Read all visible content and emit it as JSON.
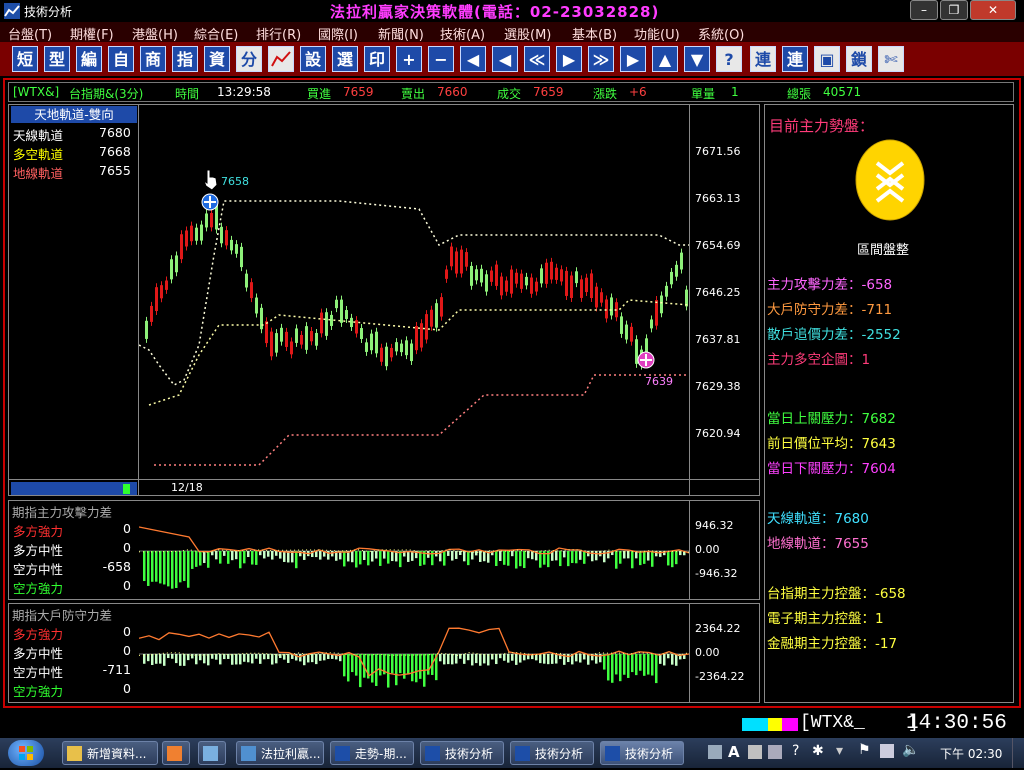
{
  "window": {
    "app_name": "技術分析",
    "heading": "法拉利贏家決策軟體(電話：02-23032828)"
  },
  "menu": [
    "台盤(T)",
    "期權(F)",
    "港盤(H)",
    "綜合(E)",
    "排行(R)",
    "國際(I)",
    "新聞(N)",
    "技術(A)",
    "選股(M)",
    "基本(B)",
    "功能(U)",
    "系統(O)"
  ],
  "toolbar": {
    "buttons": [
      "短",
      "型",
      "編",
      "自",
      "商",
      "指",
      "資",
      "分",
      "▲",
      "設",
      "選",
      "印",
      "+",
      "−",
      "◀",
      "◀",
      "≪",
      "▶",
      "≫",
      "▶",
      "▲",
      "▼",
      "?",
      "連",
      "連",
      "▣",
      "鎖",
      "✄"
    ]
  },
  "info_bar": {
    "symbol": "[WTX&]",
    "name_label": "台指期&(3分)",
    "time_label": "時間",
    "time": "13:29:58",
    "bid_label": "買進",
    "bid": "7659",
    "ask_label": "賣出",
    "ask": "7660",
    "deal_label": "成交",
    "deal": "7659",
    "change_label": "漲跌",
    "change": "+6",
    "vol_label": "單量",
    "vol": "1",
    "total_label": "總張",
    "total": "40571"
  },
  "main_chart": {
    "legend_title": "天地軌道-雙向",
    "legend": [
      {
        "label": "天線軌道",
        "value": "7680",
        "color": "#ffffff"
      },
      {
        "label": "多空軌道",
        "value": "7668",
        "color": "#ffff00"
      },
      {
        "label": "地線軌道",
        "value": "7655",
        "color": "#ff6060"
      }
    ],
    "date_label": "12/18",
    "y_ticks": [
      "7671.56",
      "7663.13",
      "7654.69",
      "7646.25",
      "7637.81",
      "7629.38",
      "7620.94"
    ],
    "high_label": "7658",
    "low_label": "7639"
  },
  "sub1": {
    "title": "期指主力攻擊力差",
    "rows": [
      {
        "label": "多方強力",
        "value": "0",
        "color": "#ff3030"
      },
      {
        "label": "多方中性",
        "value": "0",
        "color": "#ffffff"
      },
      {
        "label": "空方中性",
        "value": "-658",
        "color": "#ffffff"
      },
      {
        "label": "空方強力",
        "value": "0",
        "color": "#30ff30"
      }
    ],
    "y_ticks": [
      "946.32",
      "0.00",
      "-946.32"
    ]
  },
  "sub2": {
    "title": "期指大戶防守力差",
    "rows": [
      {
        "label": "多方強力",
        "value": "0",
        "color": "#ff3030"
      },
      {
        "label": "多方中性",
        "value": "0",
        "color": "#ffffff"
      },
      {
        "label": "空方中性",
        "value": "-711",
        "color": "#ffffff"
      },
      {
        "label": "空方強力",
        "value": "0",
        "color": "#30ff30"
      }
    ],
    "y_ticks": [
      "2364.22",
      "0.00",
      "-2364.22"
    ]
  },
  "right_panel": {
    "title": "目前主力勢盤：",
    "badge_label": "區間盤整",
    "group1": [
      {
        "text": "主力攻擊力差：-658",
        "color": "#ff66ff"
      },
      {
        "text": "大戶防守力差：-711",
        "color": "#ff9a40"
      },
      {
        "text": "散戶追價力差：-2552",
        "color": "#40e0e0"
      },
      {
        "text": "主力多空企圖：1",
        "color": "#ff3c7a"
      }
    ],
    "group2": [
      {
        "text": "當日上關壓力：7682",
        "color": "#40ff40"
      },
      {
        "text": "前日價位平均：7643",
        "color": "#ffff40"
      },
      {
        "text": "當日下關壓力：7604",
        "color": "#ff40ff"
      }
    ],
    "group3": [
      {
        "text": "天線軌道：7680",
        "color": "#40e0ff"
      },
      {
        "text": "地線軌道：7655",
        "color": "#ff70d0"
      }
    ],
    "group4": [
      {
        "text": "台指期主力控盤：-658",
        "color": "#ffff40"
      },
      {
        "text": "電子期主力控盤：1",
        "color": "#ffff40"
      },
      {
        "text": "金融期主力控盤：-17",
        "color": "#ffff40"
      }
    ]
  },
  "status_bar": {
    "symbol": "[WTX&_    ]",
    "clock": "14:30:56"
  },
  "taskbar": {
    "tasks": [
      "新增資料...",
      "",
      "",
      "法拉利贏...",
      "走勢-期...",
      "技術分析",
      "技術分析",
      "技術分析"
    ],
    "tray_ime": "A",
    "tray_time": "下午 02:30"
  },
  "colors": {
    "up": "#e01818",
    "down": "#8ef07a",
    "frame": "#c80000",
    "toolbar_bg": "#7a0000",
    "button_blue": "#1e4aa8"
  }
}
